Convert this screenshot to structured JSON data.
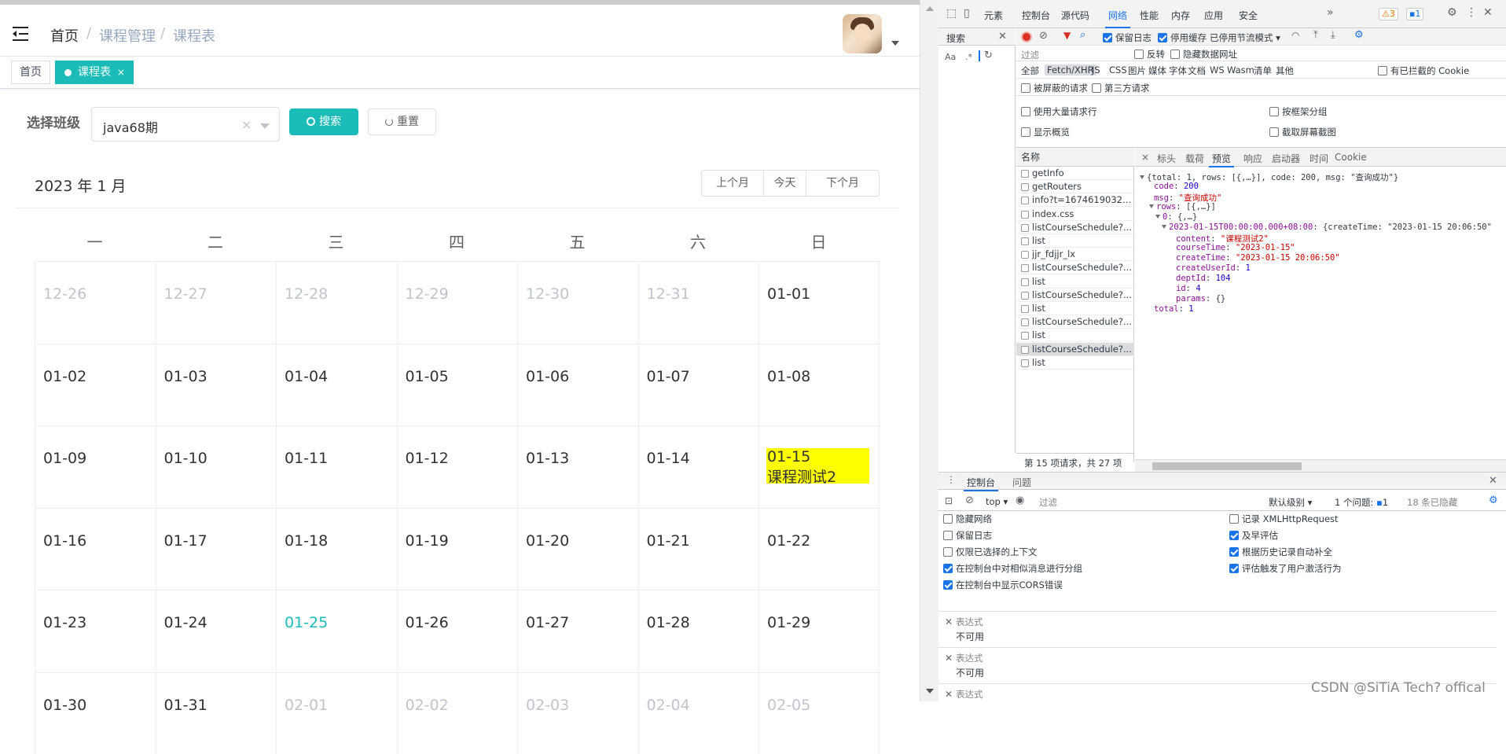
{
  "navbar": {
    "breadcrumb": [
      "首页",
      "课程管理",
      "课程表"
    ],
    "separator": "/"
  },
  "tags": [
    {
      "label": "首页",
      "active": false
    },
    {
      "label": "课程表",
      "active": true,
      "close": "×"
    }
  ],
  "search": {
    "label": "选择班级",
    "class_value": "java68期",
    "clear": "×",
    "search_button": "搜索",
    "reset_button": "重置"
  },
  "calendar": {
    "title": "2023 年 1 月",
    "nav": [
      "上个月",
      "今天",
      "下个月"
    ],
    "weekdays": [
      "一",
      "二",
      "三",
      "四",
      "五",
      "六",
      "日"
    ],
    "days": [
      [
        "12-26",
        "12-27",
        "12-28",
        "12-29",
        "12-30",
        "12-31",
        "01-01"
      ],
      [
        "01-02",
        "01-03",
        "01-04",
        "01-05",
        "01-06",
        "01-07",
        "01-08"
      ],
      [
        "01-09",
        "01-10",
        "01-11",
        "01-12",
        "01-13",
        "01-14",
        "01-15"
      ],
      [
        "01-16",
        "01-17",
        "01-18",
        "01-19",
        "01-20",
        "01-21",
        "01-22"
      ],
      [
        "01-23",
        "01-24",
        "01-25",
        "01-26",
        "01-27",
        "01-28",
        "01-29"
      ],
      [
        "01-30",
        "01-31",
        "02-01",
        "02-02",
        "02-03",
        "02-04",
        "02-05"
      ]
    ],
    "other_month": [
      "12-26",
      "12-27",
      "12-28",
      "12-29",
      "12-30",
      "12-31",
      "02-01",
      "02-02",
      "02-03",
      "02-04",
      "02-05"
    ],
    "today": "01-25",
    "event": {
      "date": "01-15",
      "content": "课程测试2",
      "color": "#ffff00"
    }
  },
  "colors": {
    "accent": "#1bbcb8",
    "devtools_blue": "#1a73e8"
  },
  "devtools": {
    "tabs": [
      "元素",
      "控制台",
      "源代码",
      "网络",
      "性能",
      "内存",
      "应用",
      "安全"
    ],
    "active_tab": "网络",
    "warnings": "3",
    "messages": "1",
    "search_panel_title": "搜索",
    "search_options": [
      "Aa",
      ".*"
    ],
    "toolbar": {
      "preserve_log": "保留日志",
      "disable_cache": "停用缓存",
      "throttle": "已停用节流模式"
    },
    "filter": {
      "placeholder": "过滤",
      "invert": "反转",
      "hide_data_urls": "隐藏数据网址"
    },
    "type_filters": [
      "全部",
      "Fetch/XHR",
      "JS",
      "CSS",
      "图片",
      "媒体",
      "字体",
      "文档",
      "WS",
      "Wasm",
      "清单",
      "其他"
    ],
    "blocked_cookies": "有已拦截的 Cookie",
    "blocked_requests": "被屏蔽的请求",
    "third_party": "第三方请求",
    "options": {
      "large_rows": "使用大量请求行",
      "group_by_frame": "按框架分组",
      "overview": "显示概览",
      "screenshots": "截取屏幕截图"
    },
    "name_header": "名称",
    "requests": [
      "getInfo",
      "getRouters",
      "info?t=16746190321...",
      "index.css",
      "listCourseSchedule?...",
      "list",
      "jjr_fdjjr_lx",
      "listCourseSchedule?...",
      "list",
      "listCourseSchedule?...",
      "list",
      "listCourseSchedule?...",
      "list",
      "listCourseSchedule?...",
      "list"
    ],
    "selected_index": 13,
    "footer": "第 15 项请求，共 27 项",
    "detail_tabs": [
      "标头",
      "载荷",
      "预览",
      "响应",
      "启动器",
      "时间",
      "Cookie"
    ],
    "detail_active": "预览",
    "close": "×",
    "json": {
      "summary": "{total: 1, rows: [{,…}], code: 200, msg: \"查询成功\"}",
      "code_key": "code",
      "code_val": "200",
      "msg_key": "msg",
      "msg_val": "\"查询成功\"",
      "rows_key": "rows",
      "rows_val": "[{,…}]",
      "row0_key": "0",
      "row0_val": "{,…}",
      "date_key": "2023-01-15T00:00:00.000+08:00",
      "date_val": "{createTime: \"2023-01-15 20:06:50\"",
      "content_key": "content",
      "content_val": "\"课程测试2\"",
      "courseTime_key": "courseTime",
      "courseTime_val": "\"2023-01-15\"",
      "createTime_key": "createTime",
      "createTime_val": "\"2023-01-15 20:06:50\"",
      "createUserId_key": "createUserId",
      "createUserId_val": "1",
      "deptId_key": "deptId",
      "deptId_val": "104",
      "id_key": "id",
      "id_val": "4",
      "params_key": "params",
      "params_val": "{}",
      "total_key": "total",
      "total_val": "1"
    },
    "console": {
      "tabs": [
        "控制台",
        "问题"
      ],
      "context": "top",
      "filter_placeholder": "过滤",
      "level": "默认级别",
      "issues": "1 个问题:",
      "issues_count": "1",
      "hidden": "18 条已隐藏",
      "settings_left": [
        "隐藏网络",
        "保留日志",
        "仅限已选择的上下文",
        "在控制台中对相似消息进行分组",
        "在控制台中显示CORS错误"
      ],
      "settings_left_checked": [
        false,
        false,
        false,
        true,
        true
      ],
      "settings_right": [
        "记录 XMLHttpRequest",
        "及早评估",
        "根据历史记录自动补全",
        "评估触发了用户激活行为"
      ],
      "settings_right_checked": [
        false,
        true,
        true,
        true
      ],
      "expressions": [
        {
          "label": "表达式",
          "value": "不可用"
        },
        {
          "label": "表达式",
          "value": "不可用"
        },
        {
          "label": "表达式",
          "value": ""
        }
      ]
    }
  },
  "watermark": "CSDN @SiTiA Tech? offical"
}
